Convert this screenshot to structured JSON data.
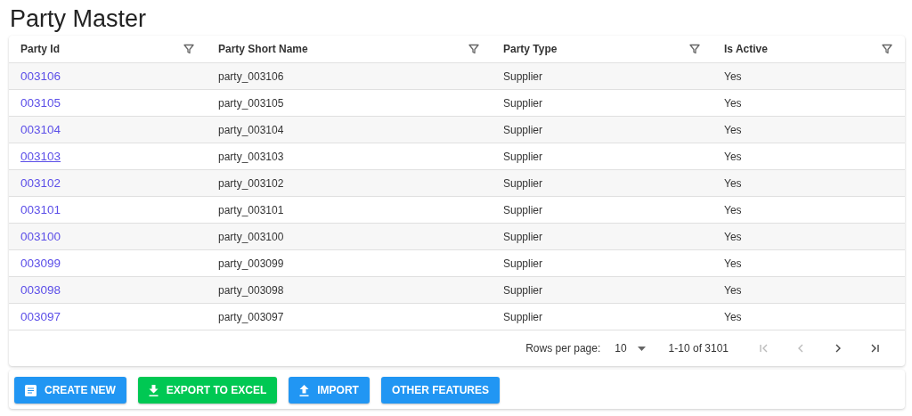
{
  "title": "Party Master",
  "table": {
    "columns": [
      {
        "label": "Party Id",
        "filter": true
      },
      {
        "label": "Party Short Name",
        "filter": true
      },
      {
        "label": "Party Type",
        "filter": true
      },
      {
        "label": "Is Active",
        "filter": true
      }
    ],
    "rows": [
      {
        "id": "003106",
        "short_name": "party_003106",
        "type": "Supplier",
        "active": "Yes",
        "hovered": false
      },
      {
        "id": "003105",
        "short_name": "party_003105",
        "type": "Supplier",
        "active": "Yes",
        "hovered": false
      },
      {
        "id": "003104",
        "short_name": "party_003104",
        "type": "Supplier",
        "active": "Yes",
        "hovered": false
      },
      {
        "id": "003103",
        "short_name": "party_003103",
        "type": "Supplier",
        "active": "Yes",
        "hovered": true
      },
      {
        "id": "003102",
        "short_name": "party_003102",
        "type": "Supplier",
        "active": "Yes",
        "hovered": false
      },
      {
        "id": "003101",
        "short_name": "party_003101",
        "type": "Supplier",
        "active": "Yes",
        "hovered": false
      },
      {
        "id": "003100",
        "short_name": "party_003100",
        "type": "Supplier",
        "active": "Yes",
        "hovered": false
      },
      {
        "id": "003099",
        "short_name": "party_003099",
        "type": "Supplier",
        "active": "Yes",
        "hovered": false
      },
      {
        "id": "003098",
        "short_name": "party_003098",
        "type": "Supplier",
        "active": "Yes",
        "hovered": false
      },
      {
        "id": "003097",
        "short_name": "party_003097",
        "type": "Supplier",
        "active": "Yes",
        "hovered": false
      }
    ]
  },
  "pagination": {
    "rows_per_page_label": "Rows per page:",
    "rows_per_page": "10",
    "range": "1-10 of 3101",
    "first_disabled": true,
    "prev_disabled": true,
    "next_disabled": false,
    "last_disabled": false
  },
  "buttons": [
    {
      "label": "CREATE NEW",
      "kind": "create",
      "color": "#2196f3"
    },
    {
      "label": "EXPORT TO EXCEL",
      "kind": "export",
      "color": "#00c853"
    },
    {
      "label": "IMPORT",
      "kind": "import",
      "color": "#2196f3"
    },
    {
      "label": "OTHER FEATURES",
      "kind": "plain",
      "color": "#2196f3"
    }
  ]
}
